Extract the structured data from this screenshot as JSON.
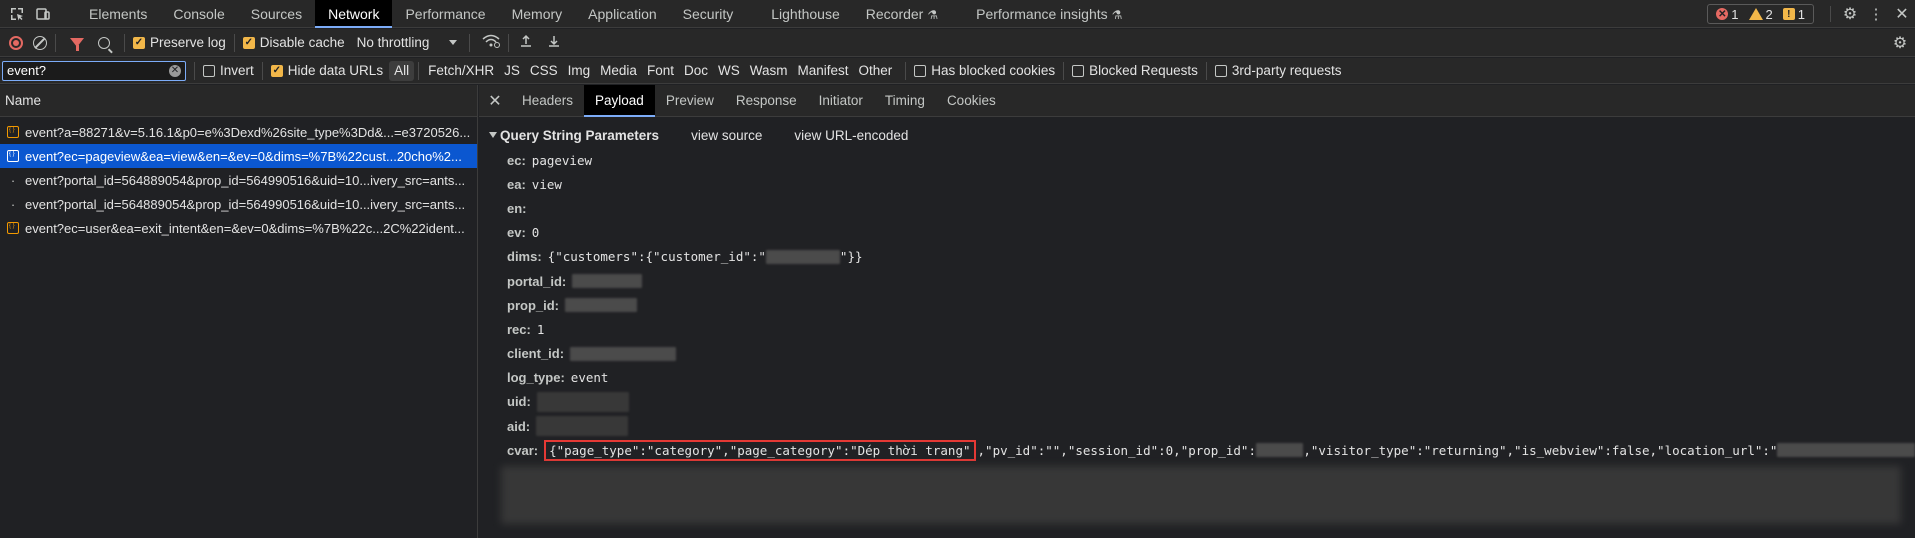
{
  "tabbar": {
    "tabs": [
      {
        "label": "Elements",
        "flask": ""
      },
      {
        "label": "Console",
        "flask": ""
      },
      {
        "label": "Sources",
        "flask": ""
      },
      {
        "label": "Network",
        "flask": "",
        "active": true
      },
      {
        "label": "Performance",
        "flask": ""
      },
      {
        "label": "Memory",
        "flask": ""
      },
      {
        "label": "Application",
        "flask": ""
      },
      {
        "label": "Security",
        "flask": ""
      },
      {
        "label": "Lighthouse",
        "flask": ""
      },
      {
        "label": "Recorder",
        "flask": "⚗"
      },
      {
        "label": "Performance insights",
        "flask": "⚗"
      }
    ],
    "errors": "1",
    "warnings": "2",
    "issues": "1"
  },
  "toolbar": {
    "preserve_log": "Preserve log",
    "disable_cache": "Disable cache",
    "throttling": "No throttling"
  },
  "filter": {
    "value": "event?",
    "invert": "Invert",
    "hide_data_urls": "Hide data URLs",
    "types": [
      "All",
      "Fetch/XHR",
      "JS",
      "CSS",
      "Img",
      "Media",
      "Font",
      "Doc",
      "WS",
      "Wasm",
      "Manifest",
      "Other"
    ],
    "has_blocked_cookies": "Has blocked cookies",
    "blocked_requests": "Blocked Requests",
    "third_party": "3rd-party requests"
  },
  "requests": {
    "header": "Name",
    "items": [
      {
        "name": "event?a=88271&v=5.16.1&p0=e%3Dexd%26site_type%3Dd&...=e3720526...",
        "icon": "json-icon"
      },
      {
        "name": "event?ec=pageview&ea=view&en=&ev=0&dims=%7B%22cust...20cho%2...",
        "icon": "json-icon",
        "selected": true
      },
      {
        "name": "event?portal_id=564889054&prop_id=564990516&uid=10...ivery_src=ants...",
        "icon": "dot"
      },
      {
        "name": "event?portal_id=564889054&prop_id=564990516&uid=10...ivery_src=ants...",
        "icon": "dot"
      },
      {
        "name": "event?ec=user&ea=exit_intent&en=&ev=0&dims=%7B%22c...2C%22ident...",
        "icon": "json-icon"
      }
    ]
  },
  "details": {
    "tabs": [
      "Headers",
      "Payload",
      "Preview",
      "Response",
      "Initiator",
      "Timing",
      "Cookies"
    ],
    "active_tab": "Payload",
    "section_title": "Query String Parameters",
    "view_source": "view source",
    "view_url_encoded": "view URL-encoded",
    "params": {
      "ec": {
        "key": "ec:",
        "value": "pageview"
      },
      "ea": {
        "key": "ea:",
        "value": "view"
      },
      "en": {
        "key": "en:",
        "value": ""
      },
      "ev": {
        "key": "ev:",
        "value": "0"
      },
      "dims": {
        "key": "dims:",
        "value_a": "{\"customers\":{\"customer_id\":\"",
        "value_b": "\"}}"
      },
      "portal_id": {
        "key": "portal_id:"
      },
      "prop_id": {
        "key": "prop_id:"
      },
      "rec": {
        "key": "rec:",
        "value": "1"
      },
      "client_id": {
        "key": "client_id:"
      },
      "log_type": {
        "key": "log_type:",
        "value": "event"
      },
      "uid": {
        "key": "uid:"
      },
      "aid": {
        "key": "aid:"
      },
      "cvar": {
        "key": "cvar:",
        "highlighted": "{\"page_type\":\"category\",\"page_category\":\"Dép thời trang\"",
        "rest_a": ",\"pv_id\":\"\",\"session_id\":0,\"prop_id\":",
        "rest_b": ",\"visitor_type\":\"returning\",\"is_webview\":false,\"location_url\":\""
      }
    }
  }
}
